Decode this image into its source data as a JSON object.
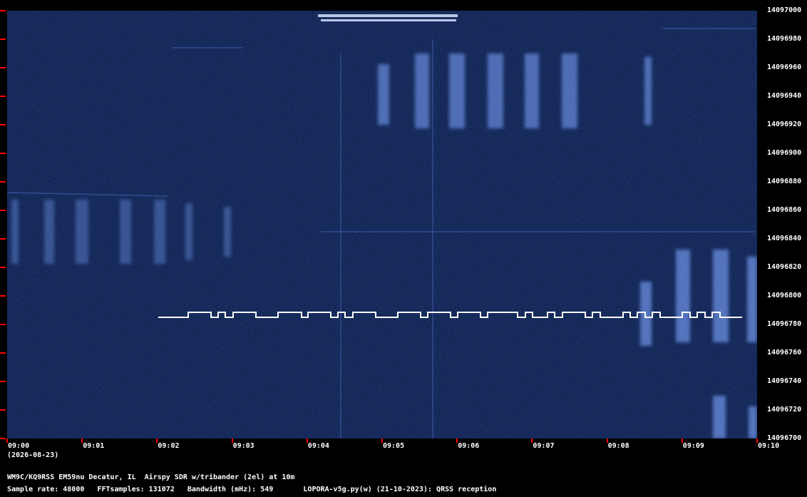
{
  "frequency_axis": {
    "labels": [
      "14097000",
      "14096980",
      "14096960",
      "14096940",
      "14096920",
      "14096900",
      "14096880",
      "14096860",
      "14096840",
      "14096820",
      "14096800",
      "14096780",
      "14096760",
      "14096740",
      "14096720",
      "14096700"
    ]
  },
  "time_axis": {
    "labels": [
      "09:00",
      "09:01",
      "09:02",
      "09:03",
      "09:04",
      "09:05",
      "09:06",
      "09:07",
      "09:08",
      "09:09",
      "09:10"
    ],
    "date": "(2026-08-23)"
  },
  "footer": {
    "line1": "WM9C/KQ9RSS EM59nu Decatur, IL  Airspy SDR w/tribander (2el) at 10m",
    "line2": "Sample rate: 48000   FFTsamples: 131072   Bandwidth (mHz): 549       LOPORA-v5g.py(w) (21-10-2023): QRSS reception"
  },
  "colors": {
    "background": "#0b1d4a",
    "tick": "#ff0000",
    "trace": "#ffffff",
    "signal": "#7fa6ff"
  }
}
